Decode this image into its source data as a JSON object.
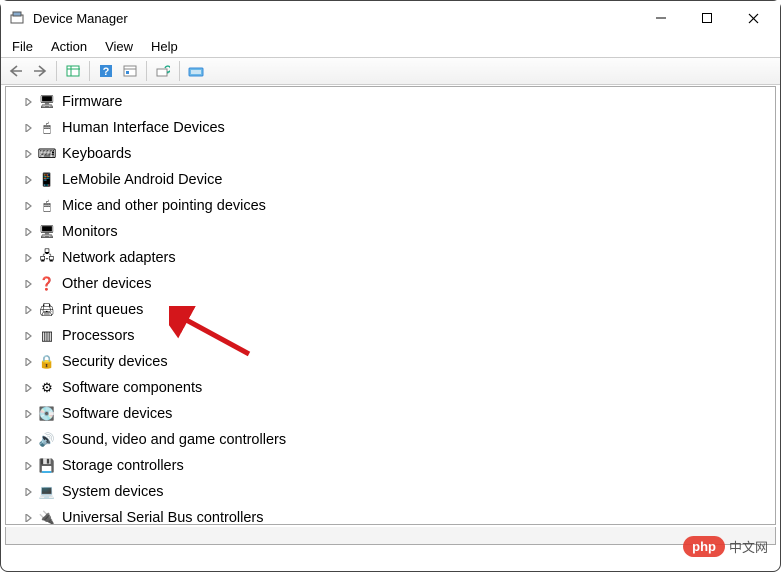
{
  "window": {
    "title": "Device Manager"
  },
  "menu": {
    "file": "File",
    "action": "Action",
    "view": "View",
    "help": "Help"
  },
  "tree": {
    "items": [
      {
        "label": "Firmware",
        "icon": "🖥"
      },
      {
        "label": "Human Interface Devices",
        "icon": "🖱"
      },
      {
        "label": "Keyboards",
        "icon": "⌨"
      },
      {
        "label": "LeMobile Android Device",
        "icon": "📱"
      },
      {
        "label": "Mice and other pointing devices",
        "icon": "🖱"
      },
      {
        "label": "Monitors",
        "icon": "🖥"
      },
      {
        "label": "Network adapters",
        "icon": "🖧"
      },
      {
        "label": "Other devices",
        "icon": "❓"
      },
      {
        "label": "Print queues",
        "icon": "🖨"
      },
      {
        "label": "Processors",
        "icon": "▥"
      },
      {
        "label": "Security devices",
        "icon": "🔒"
      },
      {
        "label": "Software components",
        "icon": "⚙"
      },
      {
        "label": "Software devices",
        "icon": "💽"
      },
      {
        "label": "Sound, video and game controllers",
        "icon": "🔊"
      },
      {
        "label": "Storage controllers",
        "icon": "💾"
      },
      {
        "label": "System devices",
        "icon": "💻"
      },
      {
        "label": "Universal Serial Bus controllers",
        "icon": "🔌"
      }
    ]
  },
  "watermark": {
    "bubble": "php",
    "text": "中文网"
  }
}
